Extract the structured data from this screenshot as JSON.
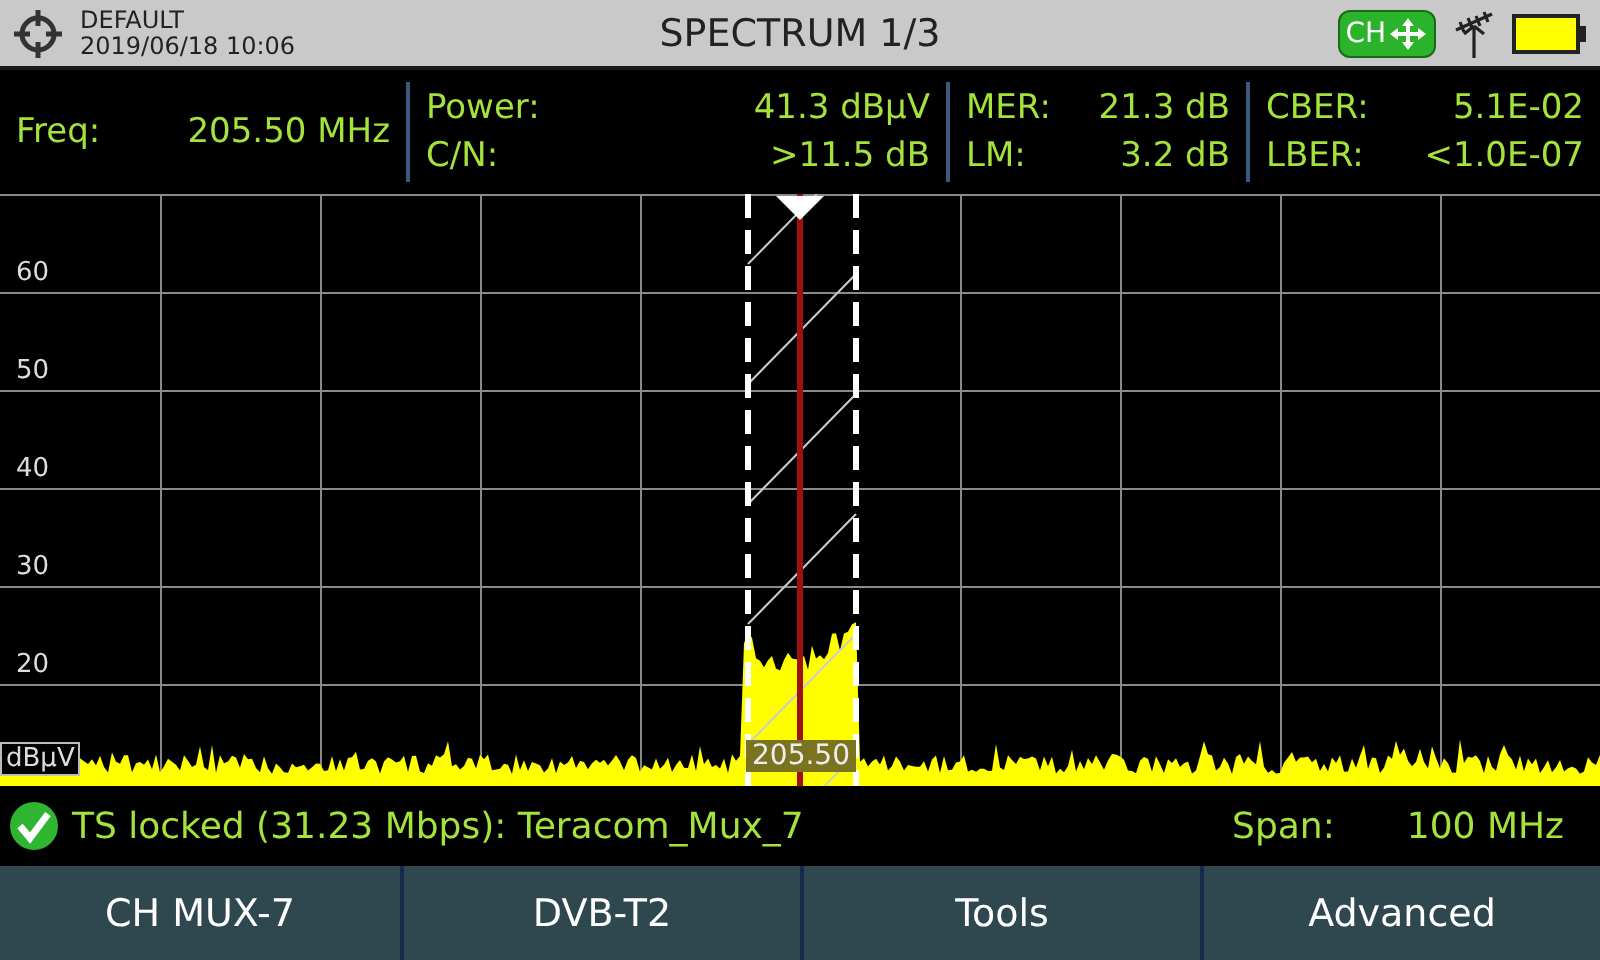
{
  "header": {
    "profile": "DEFAULT",
    "datetime": "2019/06/18 10:06",
    "title": "SPECTRUM 1/3",
    "mode_badge": "CH"
  },
  "measurements": [
    [
      {
        "label": "Freq:",
        "value": "205.50 MHz"
      }
    ],
    [
      {
        "label": "Power:",
        "value": "41.3 dBµV"
      },
      {
        "label": "C/N:",
        "value": ">11.5 dB"
      }
    ],
    [
      {
        "label": "MER:",
        "value": "21.3 dB"
      },
      {
        "label": "LM:",
        "value": "3.2 dB"
      }
    ],
    [
      {
        "label": "CBER:",
        "value": "5.1E-02"
      },
      {
        "label": "LBER:",
        "value": "<1.0E-07"
      }
    ]
  ],
  "plot": {
    "y_labels": [
      "60",
      "50",
      "40",
      "30",
      "20"
    ],
    "unit": "dBµV",
    "marker_label": "205.50"
  },
  "status": {
    "message": "TS locked (31.23 Mbps): Teracom_Mux_7",
    "span_label": "Span:",
    "span_value": "100 MHz"
  },
  "buttons": [
    "CH MUX-7",
    "DVB-T2",
    "Tools",
    "Advanced"
  ]
}
